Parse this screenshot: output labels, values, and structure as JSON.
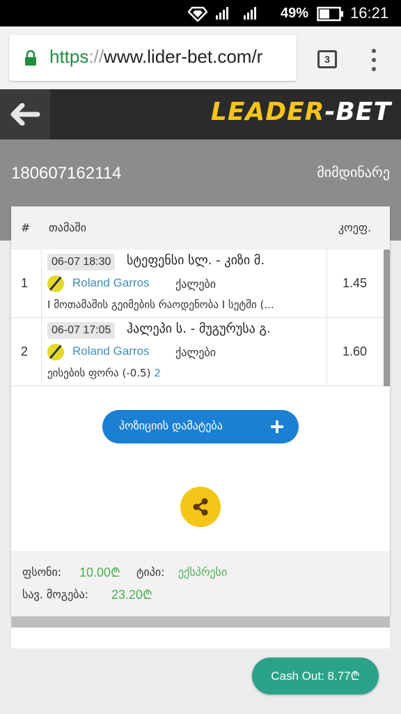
{
  "status_bar": {
    "battery": "49%",
    "time": "16:21"
  },
  "browser": {
    "url_scheme": "https",
    "url_sep": "://",
    "url_host": "www.lider-bet.com/r",
    "tab_count": "3",
    "icons": [
      "lock-icon",
      "tabs-icon",
      "overflow-menu-icon"
    ]
  },
  "app": {
    "logo_part1": "LEADER",
    "logo_part2": "-BET",
    "back_icon": "arrow-left-icon",
    "brand_colors": {
      "yellow": "#f5c518",
      "dark": "#2b2b2b"
    }
  },
  "ticket": {
    "id": "180607162114",
    "status": "მიმდინარე",
    "columns": {
      "num": "#",
      "game": "თამაში",
      "odd": "კოეფ."
    },
    "rows": [
      {
        "num": "1",
        "datetime": "06-07 18:30",
        "match": "სტეფენსი სლ. - კიზი მ.",
        "tournament": "Roland Garros",
        "category": "ქალები",
        "market": "I მოთამაშის გეიმების რაოდენობა I სეტში (...",
        "pick": "",
        "odd": "1.45"
      },
      {
        "num": "2",
        "datetime": "06-07 17:05",
        "match": "ჰალეპი ს. - მუგურუსა გ.",
        "tournament": "Roland Garros",
        "category": "ქალები",
        "market": "ეისების ფორა (-0.5) ",
        "pick": "2",
        "odd": "1.60"
      }
    ],
    "add_position_label": "პოზიციის დამატება",
    "share_icon": "share-icon",
    "summary": {
      "stake_label": "ფსონი:",
      "stake_value": "10.00₾",
      "type_label": "ტიპი:",
      "type_value": "ექსპრესი",
      "max_win_label": "სავ. მოგება:",
      "max_win_value": "23.20₾"
    },
    "cashout_label": "Cash Out: 8.77₾"
  },
  "colors": {
    "accent_blue": "#1b7fd4",
    "cashout_green": "#2aa389",
    "value_green": "#4caf50"
  }
}
